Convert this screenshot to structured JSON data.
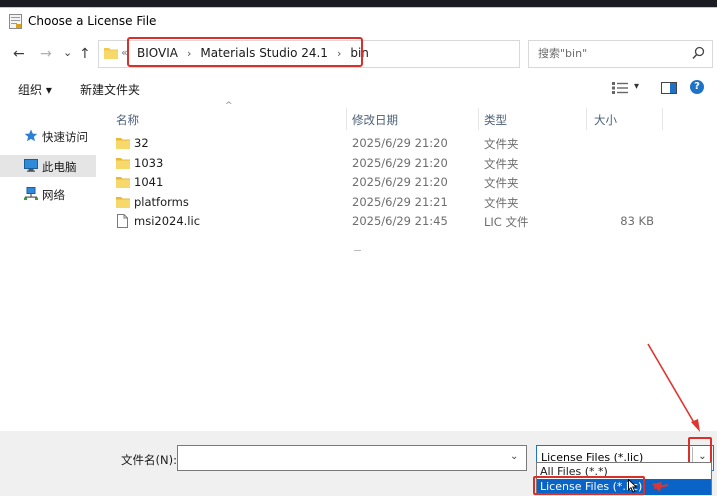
{
  "window": {
    "title": "Choose a License File"
  },
  "address": {
    "crumb_prefix": "«",
    "crumbs": [
      "BIOVIA",
      "Materials Studio 24.1",
      "bin"
    ],
    "separator": "›"
  },
  "nav_buttons": {
    "back": "←",
    "forward": "→",
    "dropdown": "⌄",
    "up": "↑",
    "refresh": "↻"
  },
  "search": {
    "placeholder": "搜索\"bin\""
  },
  "toolbar": {
    "organize": "组织 ▾",
    "new_folder": "新建文件夹",
    "view_dropdown": "▾",
    "help": "?"
  },
  "nav_pane": {
    "items": [
      {
        "label": "快速访问",
        "icon": "star-icon"
      },
      {
        "label": "此电脑",
        "icon": "computer-icon",
        "selected": true
      },
      {
        "label": "网络",
        "icon": "network-icon"
      }
    ]
  },
  "columns": {
    "name": "名称",
    "modified": "修改日期",
    "type": "类型",
    "size": "大小",
    "sort_indicator": "^"
  },
  "files": [
    {
      "name": "32",
      "modified": "2025/6/29 21:20",
      "type": "文件夹",
      "size": "",
      "icon": "folder-icon"
    },
    {
      "name": "1033",
      "modified": "2025/6/29 21:20",
      "type": "文件夹",
      "size": "",
      "icon": "folder-icon"
    },
    {
      "name": "1041",
      "modified": "2025/6/29 21:20",
      "type": "文件夹",
      "size": "",
      "icon": "folder-icon"
    },
    {
      "name": "platforms",
      "modified": "2025/6/29 21:21",
      "type": "文件夹",
      "size": "",
      "icon": "folder-icon"
    },
    {
      "name": "msi2024.lic",
      "modified": "2025/6/29 21:45",
      "type": "LIC 文件",
      "size": "83 KB",
      "icon": "file-icon"
    }
  ],
  "bottom": {
    "filename_label": "文件名(N):",
    "filename_value": "",
    "filename_dropdown": "⌄",
    "filter_value": "License Files (*.lic)",
    "filter_dropdown": "⌄",
    "filter_options": [
      "All Files (*.*)",
      "License Files (*.lic)"
    ],
    "filter_selected_index": 1
  },
  "colors": {
    "accent": "#0a64c8",
    "highlight": "#d9302c",
    "folder": "#f2c94c"
  }
}
